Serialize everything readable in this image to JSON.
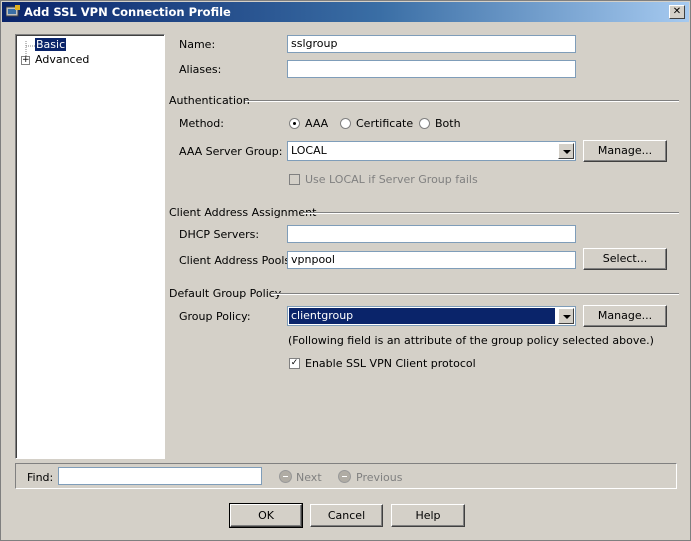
{
  "window": {
    "title": "Add SSL VPN Connection Profile",
    "close_glyph": "✕"
  },
  "tree": {
    "items": [
      {
        "label": "Basic",
        "selected": true
      },
      {
        "label": "Advanced",
        "expander": "+"
      }
    ]
  },
  "basic": {
    "name_label": "Name:",
    "name_value": "sslgroup",
    "aliases_label": "Aliases:",
    "aliases_value": ""
  },
  "authentication": {
    "heading": "Authentication",
    "method_label": "Method:",
    "methods": [
      {
        "label": "AAA",
        "checked": true
      },
      {
        "label": "Certificate",
        "checked": false
      },
      {
        "label": "Both",
        "checked": false
      }
    ],
    "server_group_label": "AAA Server Group:",
    "server_group_value": "LOCAL",
    "manage_label": "Manage...",
    "use_local_label": "Use LOCAL if Server Group fails"
  },
  "client_address": {
    "heading": "Client Address Assignment",
    "dhcp_label": "DHCP Servers:",
    "dhcp_value": "",
    "pools_label": "Client Address Pools:",
    "pools_value": "vpnpool",
    "select_label": "Select..."
  },
  "group_policy": {
    "heading": "Default Group Policy",
    "policy_label": "Group Policy:",
    "policy_value": "clientgroup",
    "manage_label": "Manage...",
    "note": "(Following field is an attribute of the group policy selected above.)",
    "enable_label": "Enable SSL VPN Client protocol",
    "enable_checked": true
  },
  "find": {
    "label": "Find:",
    "value": "",
    "next_label": "Next",
    "previous_label": "Previous"
  },
  "buttons": {
    "ok": "OK",
    "cancel": "Cancel",
    "help": "Help"
  }
}
